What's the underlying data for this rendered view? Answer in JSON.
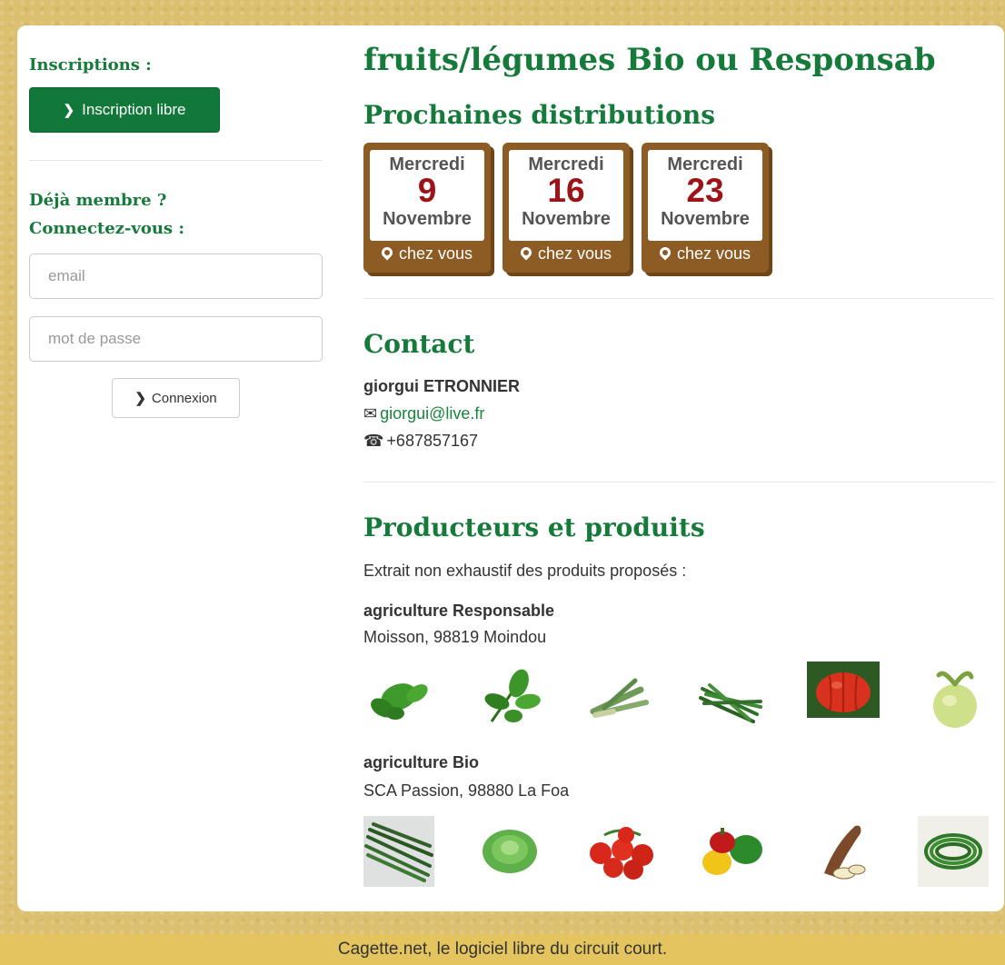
{
  "sidebar": {
    "signup_heading": "Inscriptions :",
    "signup_button": "Inscription libre",
    "login_heading_1": "Déjà membre ?",
    "login_heading_2": "Connectez-vous :",
    "email_placeholder": "email",
    "password_placeholder": "mot de passe",
    "login_button": "Connexion"
  },
  "main": {
    "title": "fruits/légumes Bio ou Responsab",
    "distributions_heading": "Prochaines distributions",
    "distributions": [
      {
        "weekday": "Mercredi",
        "day": "9",
        "month": "Novembre",
        "location": "chez vous"
      },
      {
        "weekday": "Mercredi",
        "day": "16",
        "month": "Novembre",
        "location": "chez vous"
      },
      {
        "weekday": "Mercredi",
        "day": "23",
        "month": "Novembre",
        "location": "chez vous"
      }
    ],
    "contact_heading": "Contact",
    "contact": {
      "name": "giorgui ETRONNIER",
      "email": "giorgui@live.fr",
      "phone": "+687857167"
    },
    "producers_heading": "Producteurs et produits",
    "producers_intro": "Extrait non exhaustif des produits proposés :",
    "producers": [
      {
        "name": "agriculture Responsable",
        "address": "Moisson, 98819 Moindou",
        "products": [
          "basil-leaves",
          "basil-sprig",
          "lemongrass",
          "green-beans-bunch",
          "tomato",
          "kohlrabi"
        ]
      },
      {
        "name": "agriculture Bio",
        "address": "SCA Passion, 98880 La Foa",
        "products": [
          "green-beans",
          "lettuce",
          "cherry-tomatoes",
          "bell-peppers",
          "yam",
          "long-beans"
        ]
      }
    ]
  },
  "footer": {
    "text": "Cagette.net, le logiciel libre du circuit court."
  },
  "colors": {
    "brand_green": "#157a3a",
    "calendar_brown": "#8d5c24",
    "date_red": "#9c1418",
    "background": "#dcc070"
  }
}
